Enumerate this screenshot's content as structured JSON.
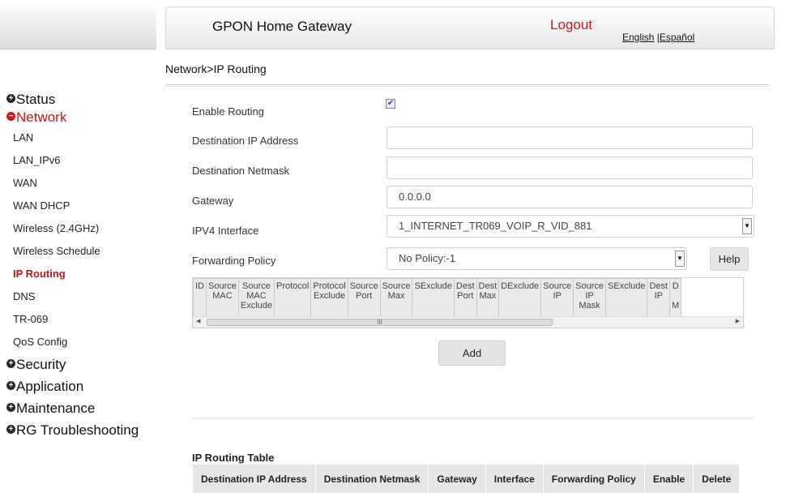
{
  "header": {
    "title": "GPON Home Gateway",
    "logout": "Logout",
    "lang_en": "English",
    "lang_sep": " |",
    "lang_es": "Español"
  },
  "breadcrumb": "Network>IP Routing",
  "sidebar": {
    "groups_top": [
      {
        "label": "Status",
        "icon": "plus-circle-icon"
      },
      {
        "label": "Network",
        "icon": "minus-circle-icon"
      }
    ],
    "network_items": [
      "LAN",
      "LAN_IPv6",
      "WAN",
      "WAN DHCP",
      "Wireless (2.4GHz)",
      "Wireless Schedule",
      "IP Routing",
      "DNS",
      "TR-069",
      "QoS Config"
    ],
    "active_item": "IP Routing",
    "groups_bottom": [
      {
        "label": "Security",
        "icon": "plus-circle-icon"
      },
      {
        "label": "Application",
        "icon": "plus-circle-icon"
      },
      {
        "label": "Maintenance",
        "icon": "plus-circle-icon"
      },
      {
        "label": "RG Troubleshooting",
        "icon": "plus-circle-icon"
      }
    ],
    "active_color": "#d01616"
  },
  "form": {
    "enable_routing_label": "Enable Routing",
    "enable_routing_checked": true,
    "dest_ip_label": "Destination IP Address",
    "dest_ip_value": "",
    "dest_mask_label": "Destination Netmask",
    "dest_mask_value": "",
    "gateway_label": "Gateway",
    "gateway_value": "0.0.0.0",
    "ipv4_if_label": "IPV4 Interface",
    "ipv4_if_value": "1_INTERNET_TR069_VOIP_R_VID_881",
    "fwd_policy_label": "Forwarding Policy",
    "fwd_policy_value": "No Policy:-1",
    "help_label": "Help",
    "add_label": "Add"
  },
  "policy_table": {
    "columns": [
      [
        "ID"
      ],
      [
        "Source",
        "MAC"
      ],
      [
        "Source",
        "MAC",
        "Exclude"
      ],
      [
        "Protocol"
      ],
      [
        "Protocol",
        "Exclude"
      ],
      [
        "Source",
        "Port"
      ],
      [
        "Source",
        "Max"
      ],
      [
        "SExclude"
      ],
      [
        "Dest",
        "Port"
      ],
      [
        "Dest",
        "Max"
      ],
      [
        "DExclude"
      ],
      [
        "Source",
        "IP"
      ],
      [
        "Source",
        "IP",
        "Mask"
      ],
      [
        "SExclude"
      ],
      [
        "Dest",
        "IP"
      ],
      [
        "D",
        "",
        "M"
      ]
    ],
    "scroll_thumb": "III"
  },
  "routing_table": {
    "title": "IP Routing Table",
    "columns": [
      "Destination IP Address",
      "Destination Netmask",
      "Gateway",
      "Interface",
      "Forwarding Policy",
      "Enable",
      "Delete"
    ]
  }
}
